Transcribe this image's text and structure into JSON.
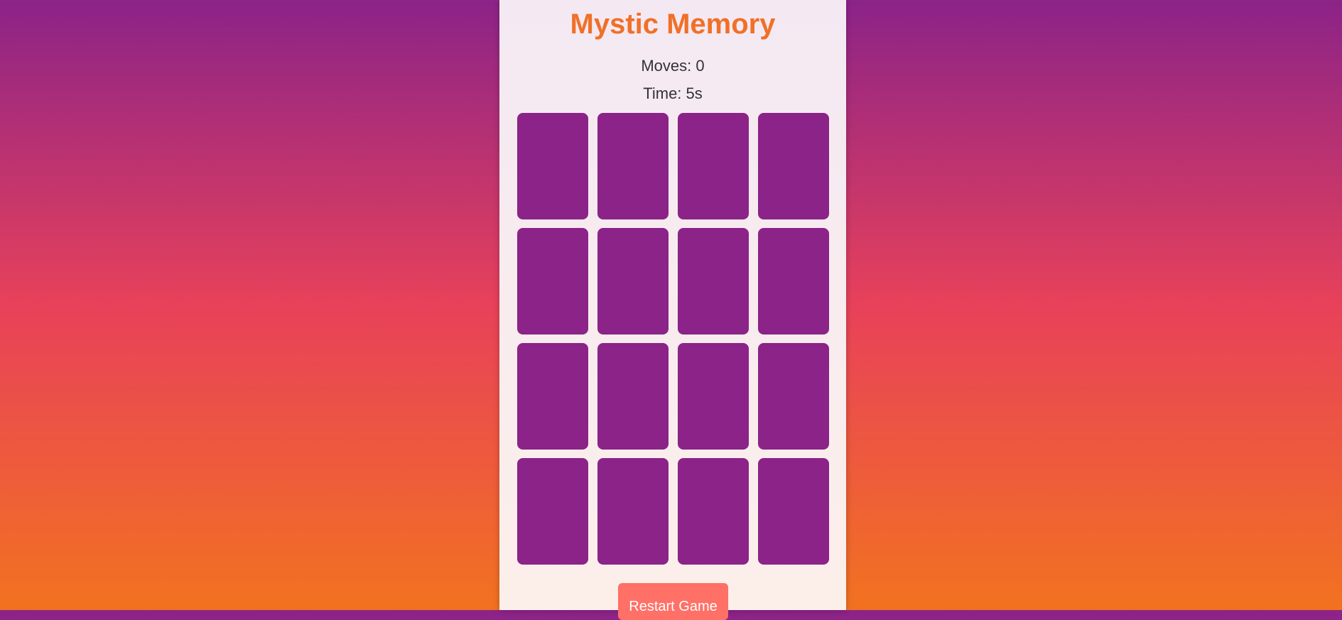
{
  "game": {
    "title": "Mystic Memory",
    "moves_text": "Moves: 0",
    "time_text": "Time: 5s",
    "restart_label": "Restart Game",
    "cards": [
      {
        "state": "face-down"
      },
      {
        "state": "face-down"
      },
      {
        "state": "face-down"
      },
      {
        "state": "face-down"
      },
      {
        "state": "face-down"
      },
      {
        "state": "face-down"
      },
      {
        "state": "face-down"
      },
      {
        "state": "face-down"
      },
      {
        "state": "face-down"
      },
      {
        "state": "face-down"
      },
      {
        "state": "face-down"
      },
      {
        "state": "face-down"
      },
      {
        "state": "face-down"
      },
      {
        "state": "face-down"
      },
      {
        "state": "face-down"
      },
      {
        "state": "face-down"
      }
    ]
  },
  "colors": {
    "card_back": "#8b2388",
    "title": "#f07028",
    "button": "#ff7066",
    "background_top": "#8b2388",
    "background_middle": "#e8415a",
    "background_bottom": "#f27220"
  }
}
